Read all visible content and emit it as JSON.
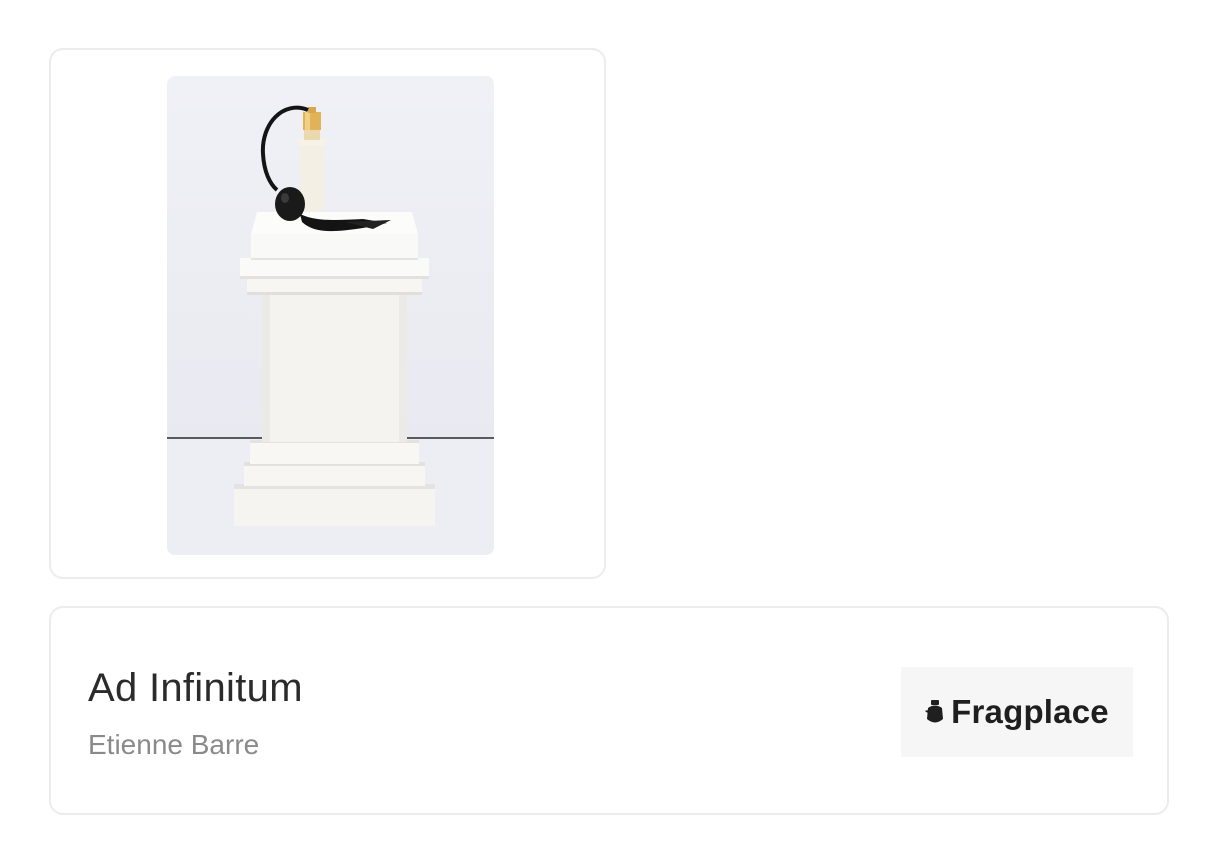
{
  "product": {
    "name": "Ad Infinitum",
    "brand": "Etienne Barre",
    "image_icon": "perfume-bottle-on-pedestal"
  },
  "store": {
    "logo_text": "Fragplace",
    "logo_icon": "bottle-icon"
  },
  "colors": {
    "card_border": "#ececec",
    "title": "#2b2b2b",
    "subtitle": "#8a8a8a",
    "logo_bg": "#f6f6f6",
    "logo_text": "#1f1f1f",
    "photo_bg": "#eeeff4",
    "gold_cap": "#e2b25a"
  }
}
